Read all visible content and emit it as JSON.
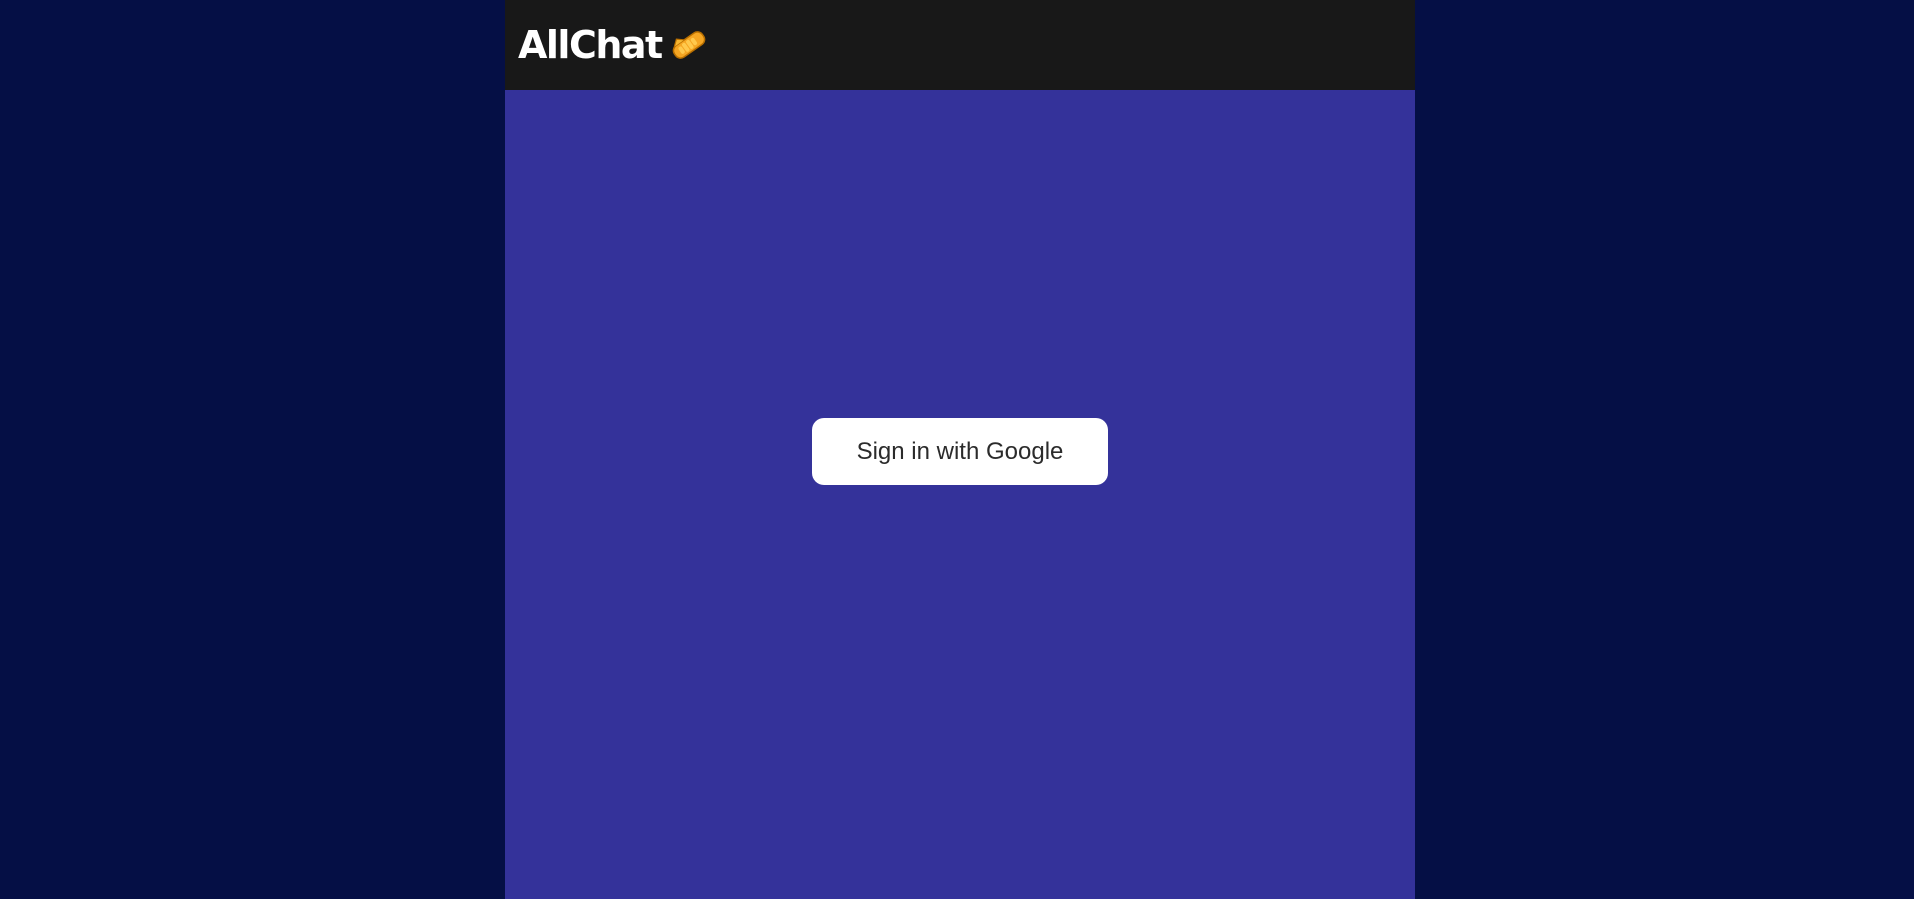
{
  "header": {
    "title": "AllChat",
    "logo_icon": "handshake-icon"
  },
  "auth": {
    "sign_in_label": "Sign in with Google"
  },
  "colors": {
    "outer_background": "#050f45",
    "app_background": "#34329a",
    "header_background": "#181818",
    "button_background": "#ffffff",
    "button_text": "#2b2b2b"
  }
}
